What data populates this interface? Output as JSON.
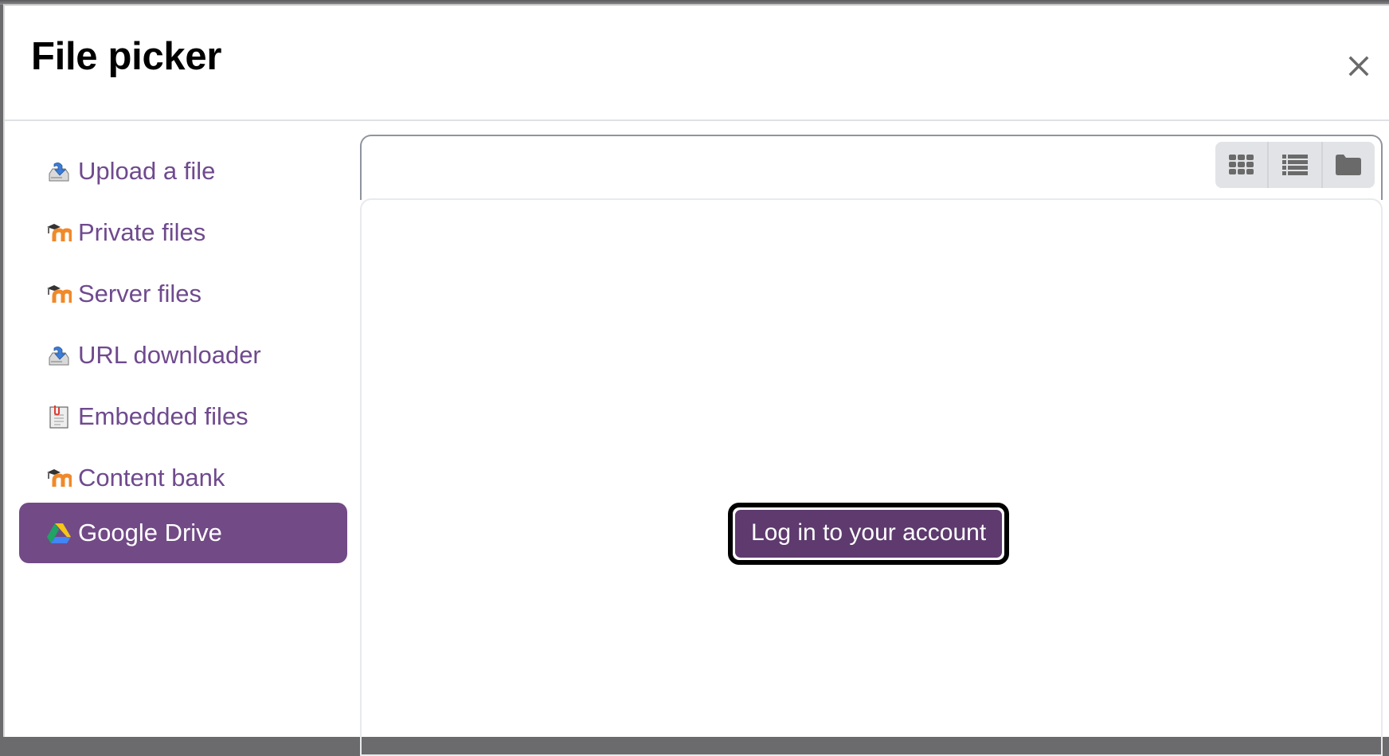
{
  "modal": {
    "title": "File picker",
    "close_icon": "close-icon"
  },
  "sidebar": {
    "items": [
      {
        "label": "Upload a file",
        "icon": "upload-drive-icon",
        "active": false
      },
      {
        "label": "Private files",
        "icon": "moodle-icon",
        "active": false
      },
      {
        "label": "Server files",
        "icon": "moodle-icon",
        "active": false
      },
      {
        "label": "URL downloader",
        "icon": "download-drive-icon",
        "active": false
      },
      {
        "label": "Embedded files",
        "icon": "clipboard-file-icon",
        "active": false
      },
      {
        "label": "Content bank",
        "icon": "moodle-icon",
        "active": false
      },
      {
        "label": "Google Drive",
        "icon": "google-drive-icon",
        "active": true
      }
    ]
  },
  "toolbar": {
    "view_buttons": [
      {
        "name": "icons-view",
        "icon": "grid-icon"
      },
      {
        "name": "list-view",
        "icon": "list-icon"
      },
      {
        "name": "tree-view",
        "icon": "folder-icon"
      }
    ]
  },
  "content": {
    "login_label": "Log in to your account"
  },
  "colors": {
    "link": "#6f4a8e",
    "active_bg": "#724a86",
    "button_bg": "#5e3a6e"
  }
}
